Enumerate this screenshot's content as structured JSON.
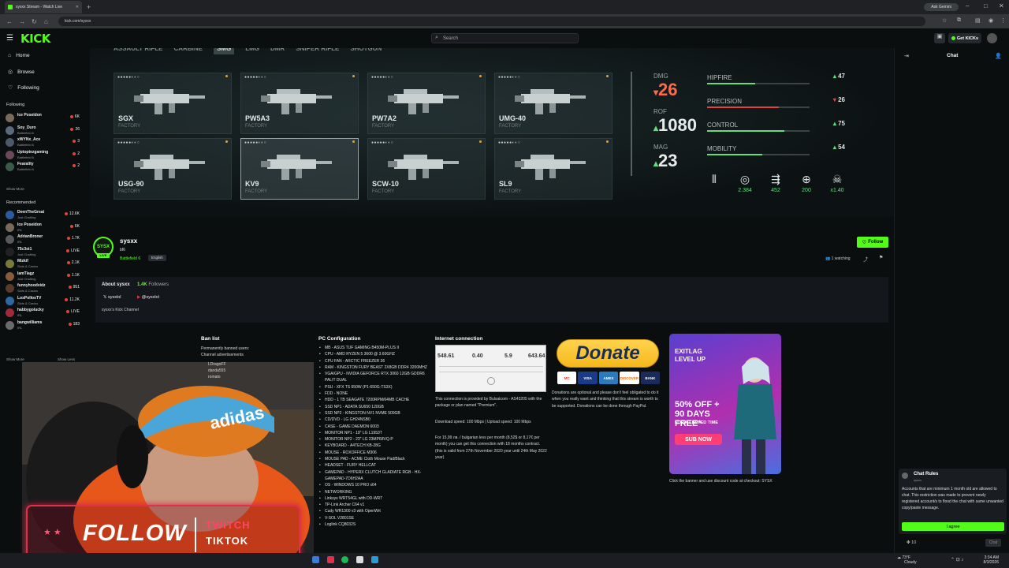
{
  "browser": {
    "tab_title": "sysxx Stream - Watch Live",
    "url": "kick.com/sysxx",
    "ask_gemini": "Ask Gemini"
  },
  "header": {
    "logo": "KICK",
    "search_placeholder": "Search",
    "get_kicks": "Get KICKs"
  },
  "sidebar": {
    "nav": [
      {
        "label": "Home",
        "icon": "home-icon"
      },
      {
        "label": "Browse",
        "icon": "browse-icon"
      },
      {
        "label": "Following",
        "icon": "heart-icon"
      }
    ],
    "following_title": "Following",
    "following": [
      {
        "name": "Ice Poseidon",
        "category": "",
        "viewers": "6K",
        "avatar_color": "#7a6a5a"
      },
      {
        "name": "Soy_Duro",
        "category": "Battlefield 6",
        "viewers": "26",
        "avatar_color": "#5a6a7a"
      },
      {
        "name": "xWYNx_Ace",
        "category": "Battlefield 6",
        "viewers": "3",
        "avatar_color": "#4a5a6a"
      },
      {
        "name": "Uptoptezgaming",
        "category": "Battlefield 6",
        "viewers": "2",
        "avatar_color": "#6a4a5a"
      },
      {
        "name": "Fearality",
        "category": "Battlefield 6",
        "viewers": "2",
        "avatar_color": "#3a5a4a"
      }
    ],
    "show_more_1": "Show More",
    "recommended_title": "Recommended",
    "recommended": [
      {
        "name": "DeenTheGreat",
        "category": "Just Chatting",
        "viewers": "12.6K",
        "avatar_color": "#2a5aa0"
      },
      {
        "name": "Ice Poseidon",
        "category": "IRL",
        "viewers": "6K",
        "avatar_color": "#7a6a5a"
      },
      {
        "name": "AdrianBroner",
        "category": "IRL",
        "viewers": "1.7K",
        "avatar_color": "#5a5a5a"
      },
      {
        "name": "75c3st1",
        "category": "Just Chatting",
        "viewers": "LIVE",
        "avatar_color": "#222"
      },
      {
        "name": "Mizkif",
        "category": "Slots & Casino",
        "viewers": "2.1K",
        "avatar_color": "#7a7a3a"
      },
      {
        "name": "IamTiagz",
        "category": "Just Chatting",
        "viewers": "1.1K",
        "avatar_color": "#8a5a3a"
      },
      {
        "name": "funnyhoodvidz",
        "category": "Slots & Casino",
        "viewers": "951",
        "avatar_color": "#5a3a2a"
      },
      {
        "name": "LosPollosTV",
        "category": "Slots & Casino",
        "viewers": "11.2K",
        "avatar_color": "#2a6aa0"
      },
      {
        "name": "habbygolucky",
        "category": "IRL",
        "viewers": "LIVE",
        "avatar_color": "#a02a3a"
      },
      {
        "name": "bangwilliams",
        "category": "IRL",
        "viewers": "183",
        "avatar_color": "#6a6a6a"
      }
    ],
    "show_more_2": "Show More",
    "show_less": "Show Less"
  },
  "video": {
    "weapon_tabs": [
      "ASSAULT RIFLE",
      "CARBINE",
      "SMG",
      "LMG",
      "DMR",
      "SNIPER RIFLE",
      "SHOTGUN"
    ],
    "selected_tab": "SMG",
    "weapons": [
      {
        "name": "SGX",
        "tag": "FACTORY"
      },
      {
        "name": "PW5A3",
        "tag": "FACTORY"
      },
      {
        "name": "PW7A2",
        "tag": "FACTORY"
      },
      {
        "name": "UMG-40",
        "tag": "FACTORY"
      },
      {
        "name": "USG-90",
        "tag": "FACTORY"
      },
      {
        "name": "KV9",
        "tag": "FACTORY"
      },
      {
        "name": "SCW-10",
        "tag": "FACTORY"
      },
      {
        "name": "SL9",
        "tag": "FACTORY"
      }
    ],
    "stats": [
      {
        "label": "DMG",
        "value": "26",
        "color": "#ff6a4a",
        "arrow": "▾"
      },
      {
        "label": "ROF",
        "value": "1080",
        "color": "#5fe07a",
        "arrow": "▴"
      },
      {
        "label": "MAG",
        "value": "23",
        "color": "#5fe07a",
        "arrow": "▴"
      }
    ],
    "bars": [
      {
        "label": "HIPFIRE",
        "value": "47",
        "fill": 0.47,
        "color": "#5fe07a",
        "arrow": "▴"
      },
      {
        "label": "PRECISION",
        "value": "26",
        "fill": 0.7,
        "color": "#e0443a",
        "arrow": "▾"
      },
      {
        "label": "CONTROL",
        "value": "75",
        "fill": 0.75,
        "color": "#5fe07a",
        "arrow": "▴"
      },
      {
        "label": "MOBILITY",
        "value": "54",
        "fill": 0.54,
        "color": "#5fe07a",
        "arrow": "▴"
      }
    ],
    "icon_stats": [
      {
        "icon": "ammo-icon",
        "value": ""
      },
      {
        "icon": "recoil-icon",
        "value": "2.384"
      },
      {
        "icon": "velocity-icon",
        "value": "452"
      },
      {
        "icon": "range-icon",
        "value": "200"
      },
      {
        "icon": "skull-icon",
        "value": "x1.40"
      }
    ]
  },
  "channel": {
    "name": "sysxx",
    "stream_title": "bf6",
    "category": "Battlefield 6",
    "language": "English",
    "live": "LIVE",
    "follow": "Follow",
    "watching": "1 watching"
  },
  "about": {
    "title": "About sysxx",
    "followers_count": "1.4K",
    "followers_label": "Followers",
    "x_handle": "sysxlol",
    "yt_handle": "@sysxlol",
    "description": "sysxx's Kick Channel"
  },
  "panels": {
    "ban_title": "Ban list",
    "ban_text": "Permanently banned users:",
    "ban_sub": "Channel advertisements",
    "ban_users": [
      "LDragoFF",
      "danda555",
      "romato"
    ],
    "pc_title": "PC Configuration",
    "pc_items": [
      "MB - ASUS TUF GAMING B450M-PLUS II",
      "CPU - AMD RYZEN 5 3600 @ 3.60GHZ",
      "CPU FAN - ARCTIC FREEZER 36",
      "RAM - KINGSTON FURY BEAST 2X8GB DDR4 3200MHZ",
      "VGA/GPU - NVIDIA GEFORCE RTX 3060 12GB GDDR6 PALIT DUAL",
      "PSU - XFX TS 650W (P1-650G-TS3X)",
      "FDD - NONE",
      "HDD - 1 TB SEAGATE 7200RPM/64MB CACHE",
      "SSD NP1 - ADATA SU650 120GB",
      "SSD NP2 - KINGSTON NV1 NVME 500GB",
      "CD/DVD - LG GH24NSB0",
      "CASE - GAME DAEMON 6003",
      "MONITOR NP1 - 19\" LG L1953T",
      "MONITOR NP2 - 23\" LG 23MP68VQ-P",
      "KEYBOARD - A4TECH KB-28G",
      "MOUSE - ROXOFFICE M306",
      "MOUSE PAD - ACME Cloth Mouse Pad/Black",
      "HEADSET - FURY HELLCAT",
      "GAMEPAD - HYPERX CLUTCH GLADIATE RGB - HX-GAMEPAD-7D6H2AA",
      "OS - WINDOWS 10 PRO x64",
      "NETWORKING",
      "Linksys WRT54GL with DD-WRT",
      "TP-Link Archer C64 v1",
      "Cudy WR1300 v3 with OpenWrt",
      "V-SOL V2801SE",
      "Loglink CQ8032S"
    ],
    "net_title": "Internet connection",
    "speed_values": [
      "548.61",
      "0.40",
      "5.9",
      "643.64"
    ],
    "net_text1": "This connection is provided by Bulsatcom - AS43205 with the package or plan named \"Premium\".",
    "net_text2": "Download speed: 100 Mbps | Upload speed: 100 Mbps",
    "net_text3": "For 15,99 лв. / bulgarian levs per month (8,52$ or 8,17€ per month) you can get this connection with 18 months contract. (this is valid from 27th November 2020 year until 24th May 2022 year)",
    "donate_label": "Donate",
    "card_labels": [
      "MC",
      "VISA",
      "AMEX",
      "DISCOVER",
      "BANK"
    ],
    "donate_text": "Donations are optional and please don't feel obligated to do it when you really want and thinking that this stream is worth to be supported. Donations can be done through PayPal.",
    "banner_brand": "EXITLAG",
    "banner_level": "LEVEL UP",
    "banner_offer": "50% OFF + 90 DAYS FREE*",
    "banner_limited": "FOR A LIMITED TIME",
    "banner_sub": "SUB NOW",
    "banner_caption": "Click the banner and use discount code at checkout: SYSX"
  },
  "overlay": {
    "follow": "FOLLOW",
    "twitch": "TWITCH",
    "tiktok": "TIKTOK"
  },
  "chat": {
    "title": "Chat",
    "rules_title": "Chat Rules",
    "rules_user": "sysxx",
    "rules_text": "Accounts that are minimum 1 month old are allowed to chat. This restriction was made to prevent newly registered account/s to flood the chat with same unwanted copy/paste message.",
    "agree": "I agree",
    "kicks": "10",
    "send": "Chat"
  },
  "taskbar": {
    "weather_temp": "73°F",
    "weather_desc": "Cloudy",
    "time": "3:34 AM",
    "date": "8/3/2026"
  }
}
